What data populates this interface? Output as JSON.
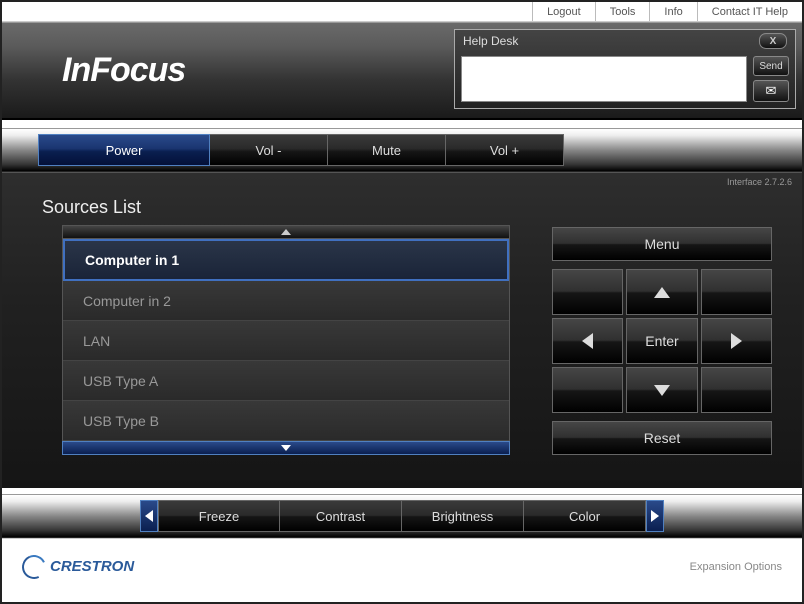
{
  "toplinks": {
    "logout": "Logout",
    "tools": "Tools",
    "info": "Info",
    "contact": "Contact IT Help"
  },
  "logo": "InFocus",
  "helpdesk": {
    "title": "Help Desk",
    "close": "X",
    "send": "Send"
  },
  "controls": {
    "power": "Power",
    "volDown": "Vol -",
    "mute": "Mute",
    "volUp": "Vol +"
  },
  "interfaceVersion": "Interface 2.7.2.6",
  "sourcesTitle": "Sources List",
  "sources": {
    "items": [
      "Computer in 1",
      "Computer in 2",
      "LAN",
      "USB Type A",
      "USB Type B"
    ],
    "selectedIndex": 0
  },
  "nav": {
    "menu": "Menu",
    "enter": "Enter",
    "reset": "Reset"
  },
  "bottom": {
    "freeze": "Freeze",
    "contrast": "Contrast",
    "brightness": "Brightness",
    "color": "Color"
  },
  "footer": {
    "brand": "CRESTRON",
    "expansion": "Expansion Options"
  }
}
